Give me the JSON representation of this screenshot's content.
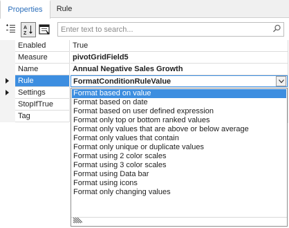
{
  "tabs": [
    {
      "label": "Properties"
    },
    {
      "label": "Rule"
    }
  ],
  "search": {
    "placeholder": "Enter text to search..."
  },
  "properties": [
    {
      "name": "Enabled",
      "value": "True"
    },
    {
      "name": "Measure",
      "value": "pivotGridField5"
    },
    {
      "name": "Name",
      "value": "Annual Negative Sales Growth"
    },
    {
      "name": "Rule",
      "value": "FormatConditionRuleValue"
    },
    {
      "name": "Settings",
      "value": ""
    },
    {
      "name": "StopIfTrue",
      "value": ""
    },
    {
      "name": "Tag",
      "value": ""
    }
  ],
  "rule_options": [
    "Format based on value",
    "Format based on date",
    "Format based on user defined expression",
    "Format only top or bottom ranked values",
    "Format only values that are above or below average",
    "Format only values that contain",
    "Format only unique or duplicate values",
    "Format using 2 color scales",
    "Format using 3 color scales",
    "Format using Data bar",
    "Format using icons",
    "Format only changing values"
  ],
  "colors": {
    "accent": "#3d8ee0",
    "tab_text_active": "#2a6ebb"
  },
  "icons": [
    "categorized-icon",
    "sort-alphabetical-icon",
    "property-pages-icon",
    "dropdown-arrow-icon",
    "search-icon",
    "resize-grip-icon"
  ]
}
